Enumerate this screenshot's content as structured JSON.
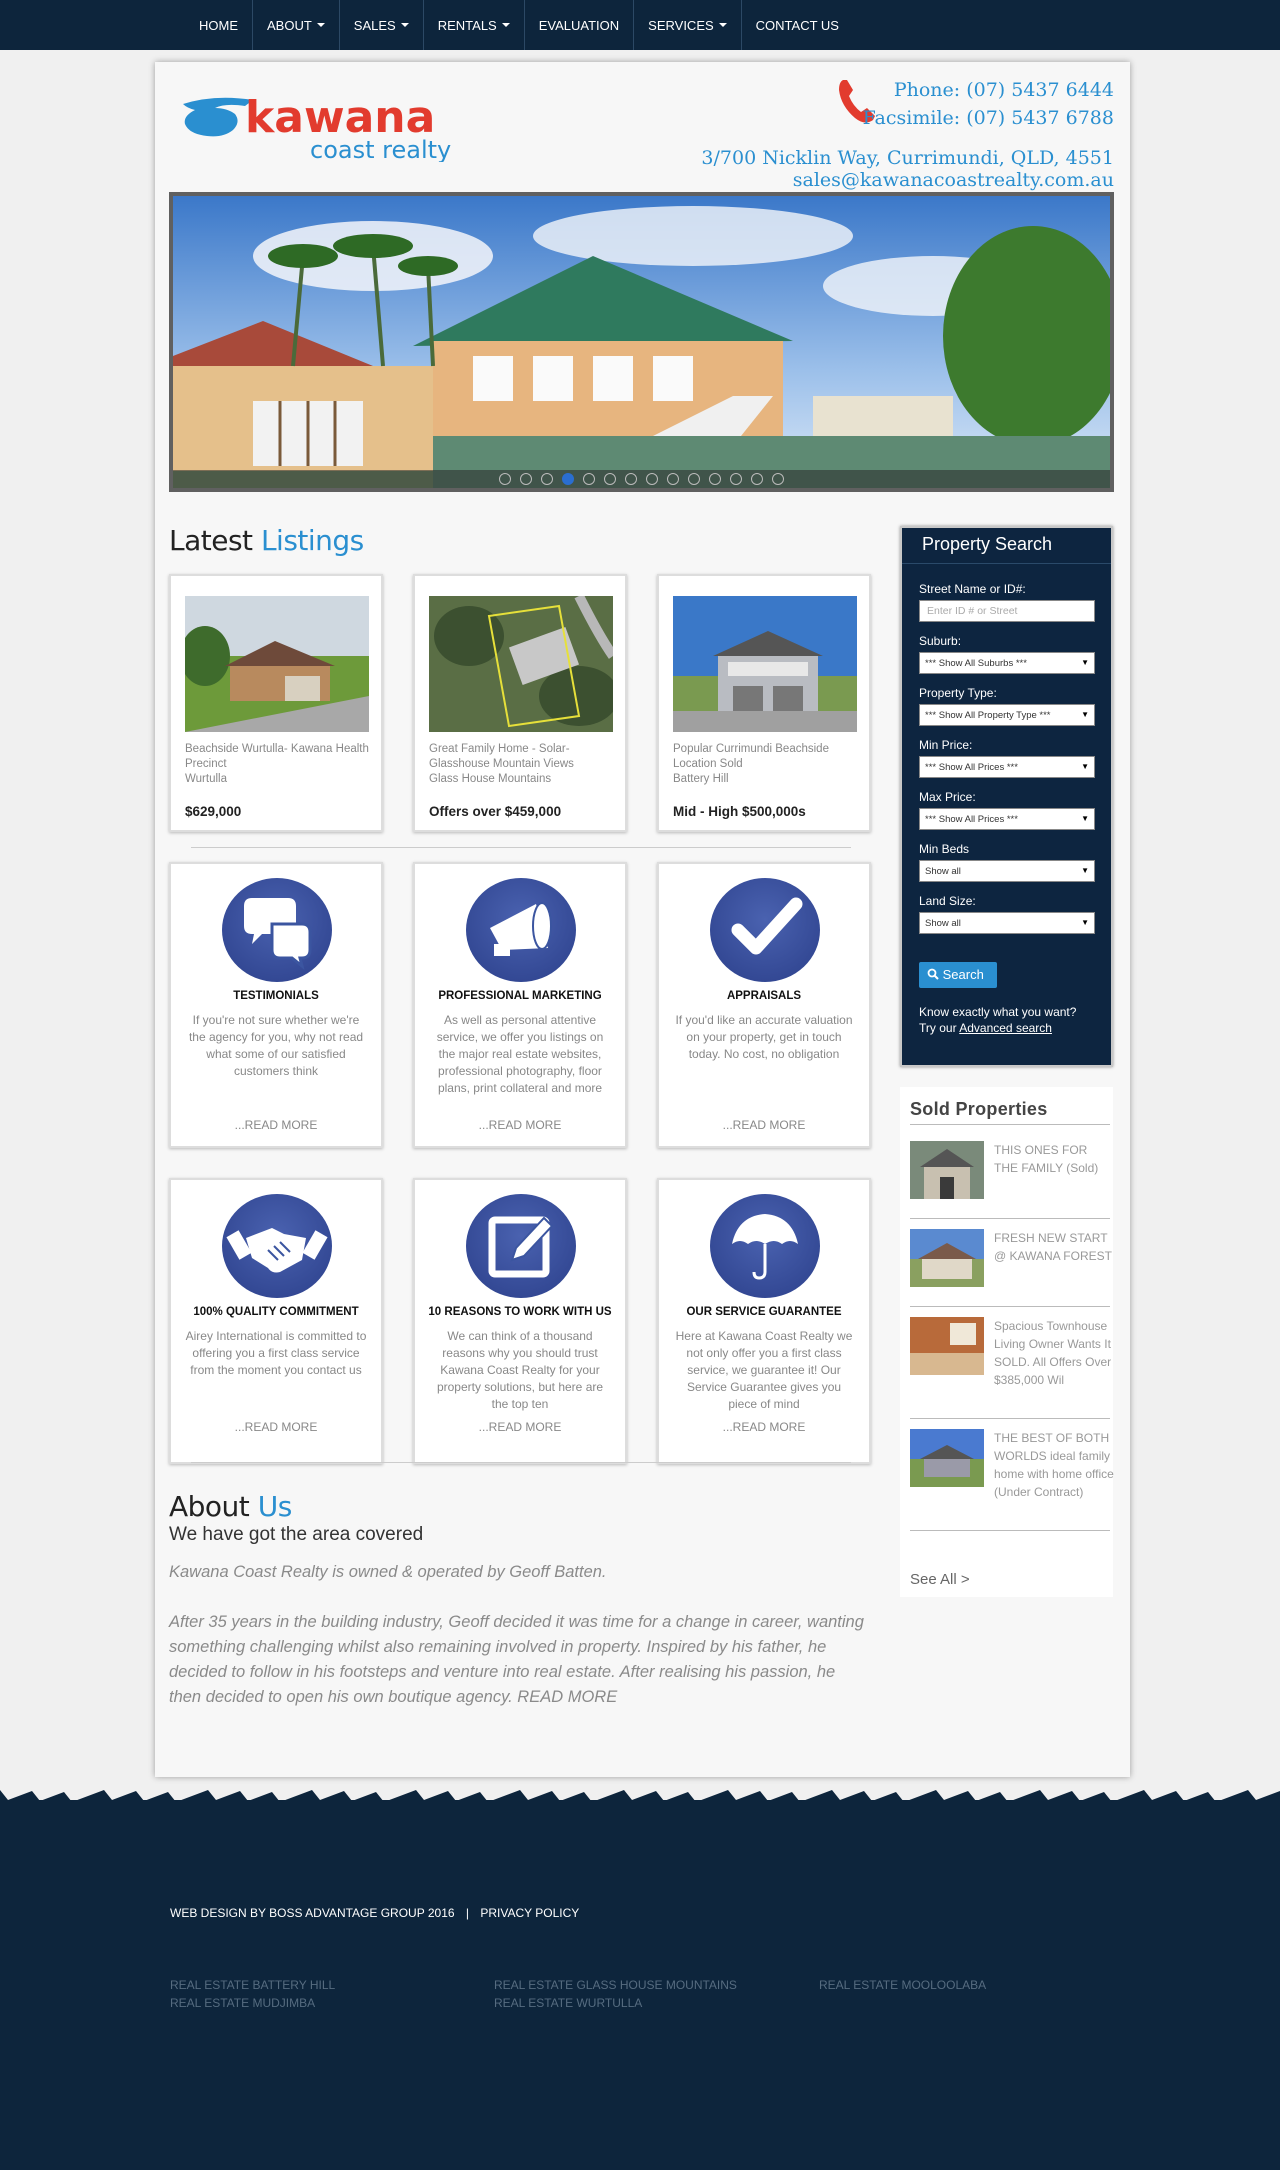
{
  "nav": {
    "items": [
      {
        "label": "HOME",
        "dropdown": false
      },
      {
        "label": "ABOUT",
        "dropdown": true
      },
      {
        "label": "SALES",
        "dropdown": true
      },
      {
        "label": "RENTALS",
        "dropdown": true
      },
      {
        "label": "EVALUATION",
        "dropdown": false
      },
      {
        "label": "SERVICES",
        "dropdown": true
      },
      {
        "label": "CONTACT US",
        "dropdown": false
      }
    ]
  },
  "header": {
    "logo_top": "kawana",
    "logo_bottom": "coast realty",
    "phone": "Phone: (07) 5437 6444",
    "fax": "Facsimile: (07) 5437 6788",
    "address": "3/700 Nicklin Way, Currimundi, QLD, 4551",
    "email": "sales@kawanacoastrealty.com.au"
  },
  "slider": {
    "dot_count": 14,
    "active_index": 3
  },
  "latest": {
    "title_a": "Latest",
    "title_b": "Listings",
    "listings": [
      {
        "desc": "Beachside Wurtulla- Kawana Health Precinct",
        "suburb": "Wurtulla",
        "price": "$629,000"
      },
      {
        "desc": "Great Family Home - Solar- Glasshouse Mountain Views",
        "suburb": "Glass House Mountains",
        "price": "Offers over $459,000"
      },
      {
        "desc": "Popular Currimundi Beachside Location Sold",
        "suburb": "Battery Hill",
        "price": "Mid - High $500,000s"
      }
    ]
  },
  "features": [
    {
      "icon": "chat-bubbles-icon",
      "title": "TESTIMONIALS",
      "text": "If you're not sure whether we're the agency for you, why not read what some of our satisfied customers think",
      "more": "...READ MORE"
    },
    {
      "icon": "megaphone-icon",
      "title": "PROFESSIONAL MARKETING",
      "text": "As well as personal attentive service, we offer you listings on the major real estate websites, professional photography, floor plans, print collateral and more",
      "more": "...READ MORE"
    },
    {
      "icon": "checkmark-icon",
      "title": "APPRAISALS",
      "text": "If you'd like an accurate valuation on your property, get in touch today. No cost, no obligation",
      "more": "...READ MORE"
    },
    {
      "icon": "handshake-icon",
      "title": "100% QUALITY COMMITMENT",
      "text": "Airey International is committed to offering you a first class service from the moment you contact us",
      "more": "...READ MORE"
    },
    {
      "icon": "edit-icon",
      "title": "10 REASONS TO WORK WITH US",
      "text": "We can think of a thousand reasons why you should trust Kawana Coast Realty for your property solutions, but here are the top ten",
      "more": "...READ MORE"
    },
    {
      "icon": "umbrella-icon",
      "title": "OUR SERVICE GUARANTEE",
      "text": "Here at Kawana Coast Realty we not only offer you a first class service, we guarantee it! Our Service Guarantee gives you piece of mind",
      "more": "...READ MORE"
    }
  ],
  "about": {
    "title_a": "About",
    "title_b": "Us",
    "subtitle": "We have got the area covered",
    "p1": "Kawana Coast Realty is owned & operated by Geoff Batten.",
    "p2": "After 35 years in the building industry, Geoff decided it was time for a change in career, wanting something challenging whilst also remaining involved in property. Inspired by his father, he decided to follow in his footsteps and venture into real estate. After realising his passion, he then decided to open his own boutique agency. READ MORE"
  },
  "search": {
    "title": "Property Search",
    "street_label": "Street Name or ID#:",
    "street_placeholder": "Enter ID # or Street",
    "suburb_label": "Suburb:",
    "suburb_value": "*** Show All Suburbs ***",
    "type_label": "Property Type:",
    "type_value": "*** Show All Property Type ***",
    "minprice_label": "Min Price:",
    "minprice_value": "*** Show All Prices ***",
    "maxprice_label": "Max Price:",
    "maxprice_value": "*** Show All Prices ***",
    "minbeds_label": "Min Beds",
    "minbeds_value": "Show all",
    "land_label": "Land Size:",
    "land_value": "Show all",
    "button": "Search",
    "know_line1": "Know exactly what you want?",
    "know_prefix": "Try our",
    "advanced_link": "Advanced search"
  },
  "sold": {
    "title": "Sold Properties",
    "items": [
      {
        "text": "THIS ONES FOR THE FAMILY (Sold)"
      },
      {
        "text": "FRESH NEW START @ KAWANA FOREST"
      },
      {
        "text": "Spacious Townhouse Living Owner Wants It SOLD. All Offers Over $385,000 Wil"
      },
      {
        "text": "THE BEST OF BOTH WORLDS ideal family home with home office (Under Contract)"
      }
    ],
    "see_all": "See All >"
  },
  "footer": {
    "credit": "WEB DESIGN BY BOSS ADVANTAGE GROUP 2016",
    "sep": "|",
    "privacy": "PRIVACY POLICY",
    "links": [
      "REAL ESTATE BATTERY HILL",
      "REAL ESTATE MUDJIMBA",
      "REAL ESTATE GLASS HOUSE MOUNTAINS",
      "REAL ESTATE WURTULLA",
      "REAL ESTATE MOOLOOLABA"
    ]
  },
  "colors": {
    "navy": "#0d253c",
    "accent": "#2a8fd0",
    "logo_red": "#e23b2e",
    "icon_blue": "#2b3f8a"
  }
}
